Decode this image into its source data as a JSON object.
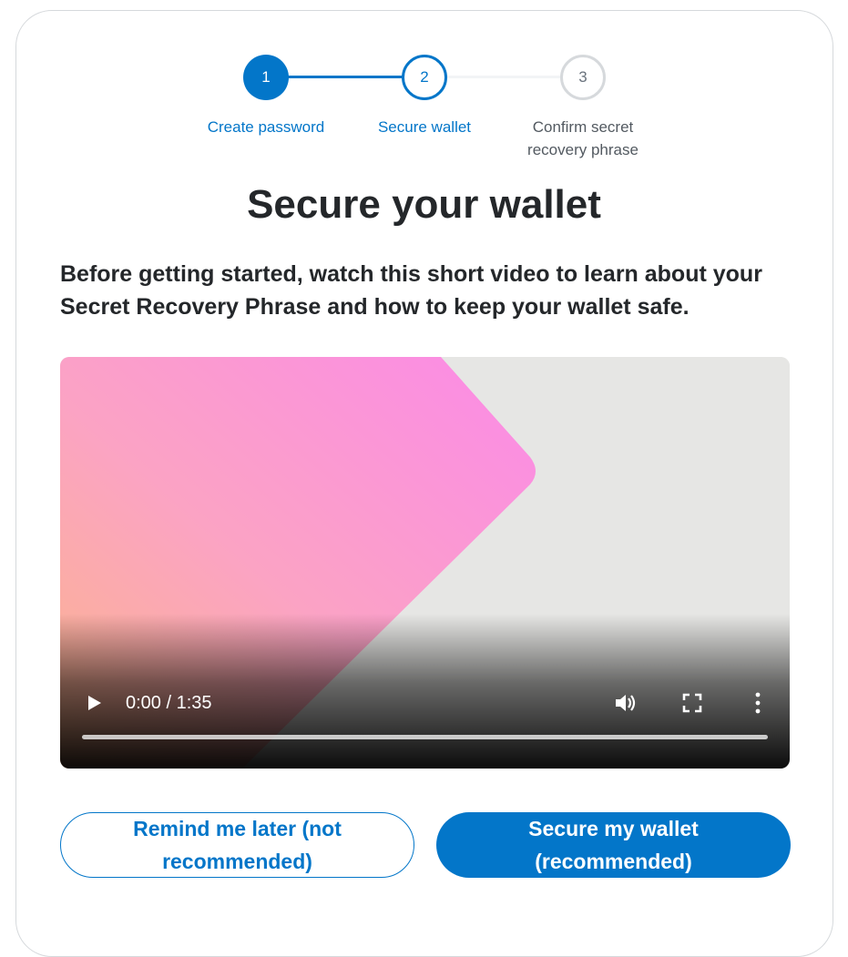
{
  "stepper": {
    "steps": [
      {
        "number": "1",
        "label": "Create password",
        "state": "completed"
      },
      {
        "number": "2",
        "label": "Secure wallet",
        "state": "active"
      },
      {
        "number": "3",
        "label": "Confirm secret recovery phrase",
        "state": "inactive"
      }
    ]
  },
  "page": {
    "title": "Secure your wallet",
    "description": "Before getting started, watch this short video to learn about your Secret Recovery Phrase and how to keep your wallet safe."
  },
  "video": {
    "time": "0:00 / 1:35",
    "progress": 0,
    "icons": [
      "play-icon",
      "volume-icon",
      "fullscreen-icon",
      "more-options-icon"
    ]
  },
  "buttons": {
    "remind_later": "Remind me later (not recommended)",
    "secure_wallet": "Secure my wallet (recommended)"
  },
  "colors": {
    "primary": "#0376c9",
    "inactive_border": "#d6d9dc",
    "text": "#24272a"
  }
}
